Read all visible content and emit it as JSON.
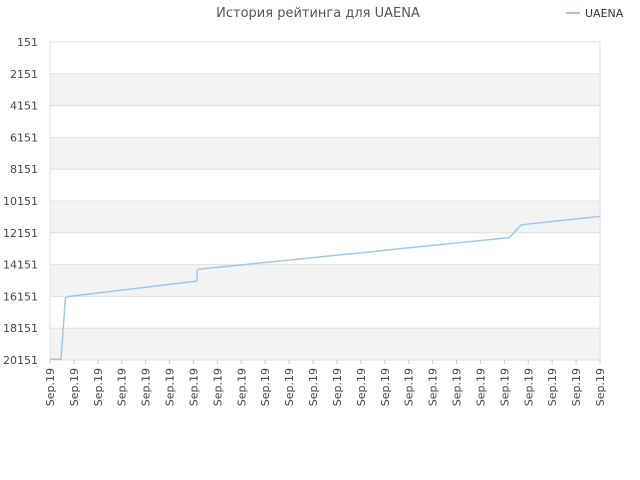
{
  "chart_data": {
    "type": "line",
    "title": "История рейтинга для UAENA",
    "xlabel": "",
    "ylabel": "",
    "y_inverted": true,
    "ylim": [
      151,
      20151
    ],
    "yticks": [
      "151",
      "2151",
      "4151",
      "6151",
      "8151",
      "10151",
      "12151",
      "14151",
      "16151",
      "18151",
      "20151"
    ],
    "xticks": [
      "Sep.19",
      "Sep.19",
      "Sep.19",
      "Sep.19",
      "Sep.19",
      "Sep.19",
      "Sep.19",
      "Sep.19",
      "Sep.19",
      "Sep.19",
      "Sep.19",
      "Sep.19",
      "Sep.19",
      "Sep.19",
      "Sep.19",
      "Sep.19",
      "Sep.19",
      "Sep.19",
      "Sep.19",
      "Sep.19",
      "Sep.19",
      "Sep.19",
      "Sep.19",
      "Sep.19"
    ],
    "grid": true,
    "legend_position": "top-right",
    "colors": {
      "line": "#9ec9ec",
      "band": "#f2f2f2",
      "grid": "#e0e0e0"
    },
    "series": [
      {
        "name": "UAENA",
        "x": [
          0,
          0.02,
          0.028,
          0.035,
          0.267,
          0.268,
          0.835,
          0.857,
          1.0
        ],
        "values": [
          20100,
          20100,
          16251,
          16151,
          15191,
          14451,
          12451,
          11651,
          11121
        ]
      }
    ]
  }
}
